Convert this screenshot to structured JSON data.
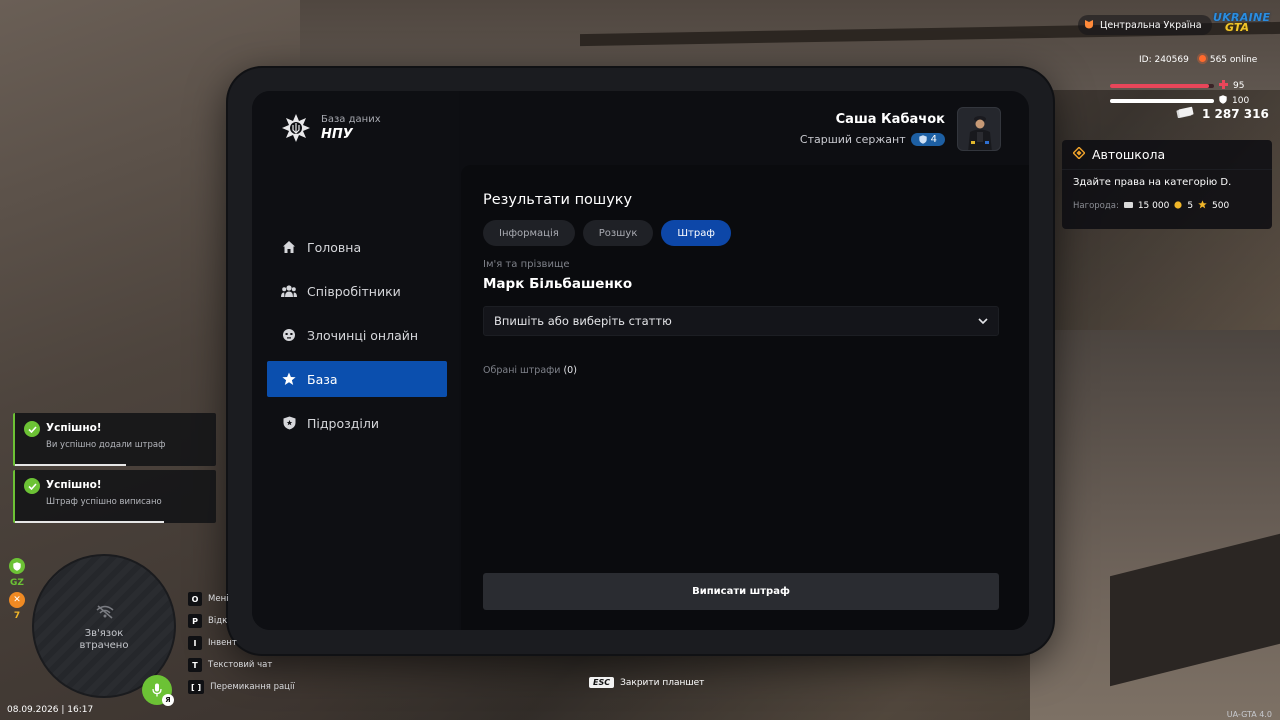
{
  "app": {
    "brand_subtitle": "База даних",
    "brand_title": "НПУ"
  },
  "user": {
    "name": "Саша Кабачок",
    "rank": "Старший сержант",
    "rank_level": "4"
  },
  "nav": {
    "items": [
      {
        "label": "Головна",
        "icon": "home-icon"
      },
      {
        "label": "Співробітники",
        "icon": "people-icon"
      },
      {
        "label": "Злочинці онлайн",
        "icon": "mask-icon"
      },
      {
        "label": "База",
        "icon": "star-icon",
        "active": true
      },
      {
        "label": "Підрозділи",
        "icon": "shield-icon"
      }
    ]
  },
  "main": {
    "title": "Результати пошуку",
    "tabs": [
      {
        "label": "Інформація"
      },
      {
        "label": "Розшук"
      },
      {
        "label": "Штраф",
        "active": true
      }
    ],
    "name_label": "Ім'я та прізвище",
    "person_name": "Марк Більбашенко",
    "select_placeholder": "Впишіть або виберіть статтю",
    "selected_fines_label": "Обрані штрафи",
    "selected_fines_count": "(0)",
    "submit_label": "Виписати штраф"
  },
  "hud": {
    "region": "Центральна Україна",
    "logo_line1": "UKRAINE",
    "logo_line2": "GTA",
    "player_id": "ID: 240569",
    "online": "565 online",
    "health": "95",
    "armor": "100",
    "health_fraction": 0.95,
    "armor_fraction": 1.0,
    "money": "1 287 316",
    "accent_health": "#e8465a",
    "accent_success": "#6cc235",
    "accent_primary": "#0b4fae"
  },
  "quest": {
    "title": "Автошкола",
    "description": "Здайте права на категорію D.",
    "reward_label": "Нагорода:",
    "reward_money": "15 000",
    "reward_coins": "5",
    "reward_stars": "500"
  },
  "toasts": [
    {
      "title": "Успішно!",
      "message": "Ви успішно додали штраф",
      "progress": 0.55
    },
    {
      "title": "Успішно!",
      "message": "Штраф успішно виписано",
      "progress": 0.74
    }
  ],
  "minimap": {
    "status": "Зв'язок\nвтрачено",
    "gz_label": "GZ",
    "wanted_count": "7"
  },
  "keybinds": [
    {
      "key": "O",
      "label": "Мені"
    },
    {
      "key": "P",
      "label": "Відк"
    },
    {
      "key": "I",
      "label": "Інвент"
    },
    {
      "key": "T",
      "label": "Текстовий чат"
    },
    {
      "key": "[ ]",
      "label": "Перемикання рації"
    }
  ],
  "datetime": "08.09.2026 | 16:17",
  "esc_hint": {
    "key": "ESC",
    "label": "Закрити планшет"
  },
  "version": "UA-GTA 4.0"
}
